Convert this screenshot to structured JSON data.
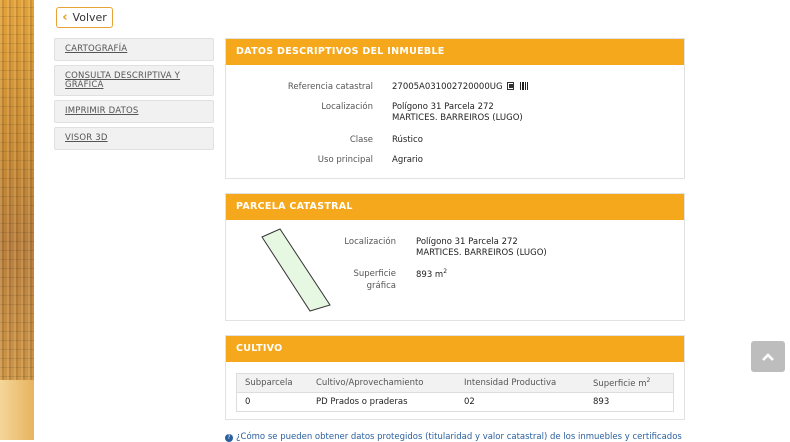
{
  "back_button": {
    "label": "Volver",
    "icon": "chevron-left-icon"
  },
  "sidebar": {
    "items": [
      {
        "label": "CARTOGRAFÍA"
      },
      {
        "label": "CONSULTA DESCRIPTIVA Y GRÁFICA"
      },
      {
        "label": "IMPRIMIR DATOS"
      },
      {
        "label": "VISOR 3D"
      }
    ]
  },
  "datos": {
    "title": "DATOS DESCRIPTIVOS DEL INMUEBLE",
    "ref_label": "Referencia catastral",
    "ref_value": "27005A031002720000UG",
    "loc_label": "Localización",
    "loc_line1": "Polígono 31 Parcela 272",
    "loc_line2": "MARTICES. BARREIROS (LUGO)",
    "clase_label": "Clase",
    "clase_value": "Rústico",
    "uso_label": "Uso principal",
    "uso_value": "Agrario"
  },
  "parcela": {
    "title": "PARCELA CATASTRAL",
    "loc_label": "Localización",
    "loc_line1": "Polígono 31 Parcela 272",
    "loc_line2": "MARTICES. BARREIROS (LUGO)",
    "sup_label_1": "Superficie",
    "sup_label_2": "gráfica",
    "sup_value": "893 m",
    "sup_unit_exp": "2"
  },
  "cultivo": {
    "title": "CULTIVO",
    "headers": [
      "Subparcela",
      "Cultivo/Aprovechamiento",
      "Intensidad Productiva",
      "Superficie m"
    ],
    "header_exp": "2",
    "rows": [
      [
        "0",
        "PD Prados o praderas",
        "02",
        "893"
      ]
    ]
  },
  "footer": {
    "link_text": "¿Cómo se pueden obtener datos protegidos (titularidad y valor catastral) de los inmuebles y certificados"
  },
  "colors": {
    "accent": "#f6a81c",
    "parcel_fill": "#e6f7e2"
  }
}
